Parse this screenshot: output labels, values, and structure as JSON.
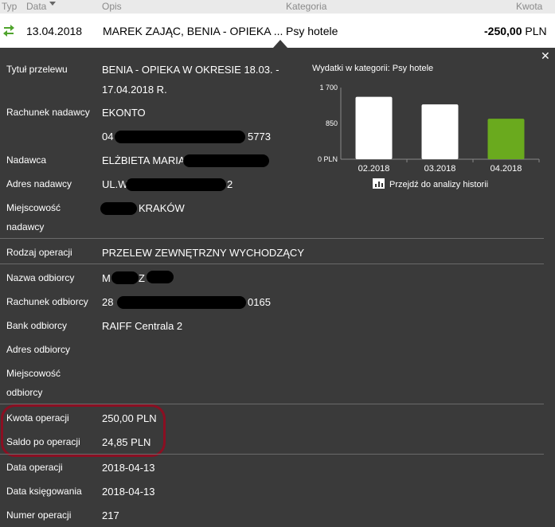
{
  "header": {
    "typ": "Typ",
    "data": "Data",
    "opis": "Opis",
    "kategoria": "Kategoria",
    "kwota": "Kwota"
  },
  "transaction": {
    "date": "13.04.2018",
    "description": "MAREK ZAJĄC, BENIA - OPIEKA ...",
    "category": "Psy hotele",
    "amount": "-250,00",
    "currency": "PLN",
    "icon": "transfer-arrows-icon"
  },
  "details": {
    "tytul_label": "Tytuł przelewu",
    "tytul_value_1": "BENIA - OPIEKA W OKRESIE 18.03. -",
    "tytul_value_2": "17.04.2018 R.",
    "rachunek_nadawcy_label": "Rachunek nadawcy",
    "rachunek_nadawcy_bank": "EKONTO",
    "rachunek_nadawcy_prefix": "04",
    "rachunek_nadawcy_suffix": "5773",
    "nadawca_label": "Nadawca",
    "nadawca_value": "ELŻBIETA MARIA",
    "adres_nadawcy_label": "Adres nadawcy",
    "adres_nadawcy_prefix": "UL.W",
    "adres_nadawcy_suffix": "2",
    "miejscowosc_nadawcy_label_1": "Miejscowość",
    "miejscowosc_nadawcy_label_2": "nadawcy",
    "miejscowosc_nadawcy_value": "KRAKÓW",
    "rodzaj_label": "Rodzaj operacji",
    "rodzaj_value": "PRZELEW ZEWNĘTRZNY WYCHODZĄCY",
    "nazwa_odbiorcy_label": "Nazwa odbiorcy",
    "nazwa_odbiorcy_prefix": "M",
    "nazwa_odbiorcy_mid": "Z",
    "rachunek_odbiorcy_label": "Rachunek odbiorcy",
    "rachunek_odbiorcy_prefix": "28",
    "rachunek_odbiorcy_suffix": "0165",
    "bank_odbiorcy_label": "Bank odbiorcy",
    "bank_odbiorcy_value": "RAIFF Centrala 2",
    "adres_odbiorcy_label": "Adres odbiorcy",
    "miejscowosc_odbiorcy_label_1": "Miejscowość",
    "miejscowosc_odbiorcy_label_2": "odbiorcy",
    "kwota_label": "Kwota operacji",
    "kwota_value": "250,00 PLN",
    "saldo_label": "Saldo po operacji",
    "saldo_value": "24,85 PLN",
    "data_operacji_label": "Data operacji",
    "data_operacji_value": "2018-04-13",
    "data_ksiegowania_label": "Data księgowania",
    "data_ksiegowania_value": "2018-04-13",
    "numer_label": "Numer operacji",
    "numer_value": "217"
  },
  "chart": {
    "title": "Wydatki w kategorii:  Psy hotele",
    "history_link": "Przejdź do analizy historii"
  },
  "chart_data": {
    "type": "bar",
    "categories": [
      "02.2018",
      "03.2018",
      "04.2018"
    ],
    "values": [
      1480,
      1300,
      960
    ],
    "yticks": [
      "0 PLN",
      "850",
      "1 700"
    ],
    "ylim": [
      0,
      1700
    ],
    "colors": [
      "#ffffff",
      "#ffffff",
      "#6aaa1e"
    ]
  },
  "colors": {
    "highlight_border": "#8a0f22",
    "panel_bg": "#3a3a3a",
    "bar_current": "#6aaa1e"
  }
}
